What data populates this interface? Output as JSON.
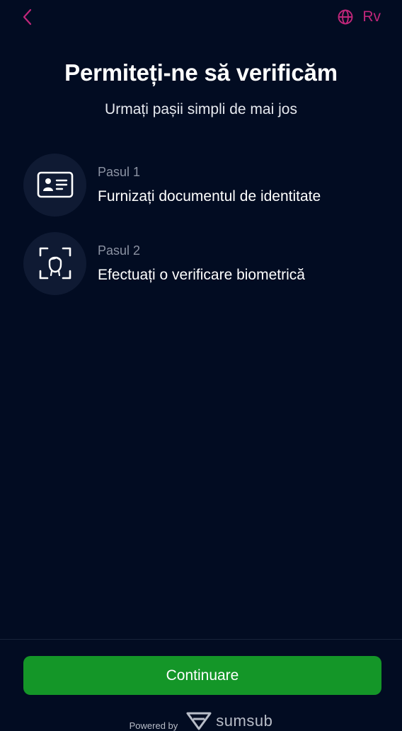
{
  "header": {
    "back_icon": "chevron-left-icon",
    "language_icon": "globe-icon",
    "language_label": "Rv",
    "accent_color": "#c0267a"
  },
  "main": {
    "title": "Permiteți-ne să verificăm",
    "subtitle": "Urmați pașii simpli de mai jos",
    "steps": [
      {
        "label": "Pasul 1",
        "title": "Furnizați documentul de identitate",
        "icon": "id-card-icon"
      },
      {
        "label": "Pasul 2",
        "title": "Efectuați o verificare biometrică",
        "icon": "face-scan-icon"
      }
    ]
  },
  "footer": {
    "continue_label": "Continuare",
    "continue_color": "#149628",
    "powered_by_label": "Powered by",
    "brand_name": "sumsub",
    "brand_icon": "sumsub-logo-icon"
  }
}
